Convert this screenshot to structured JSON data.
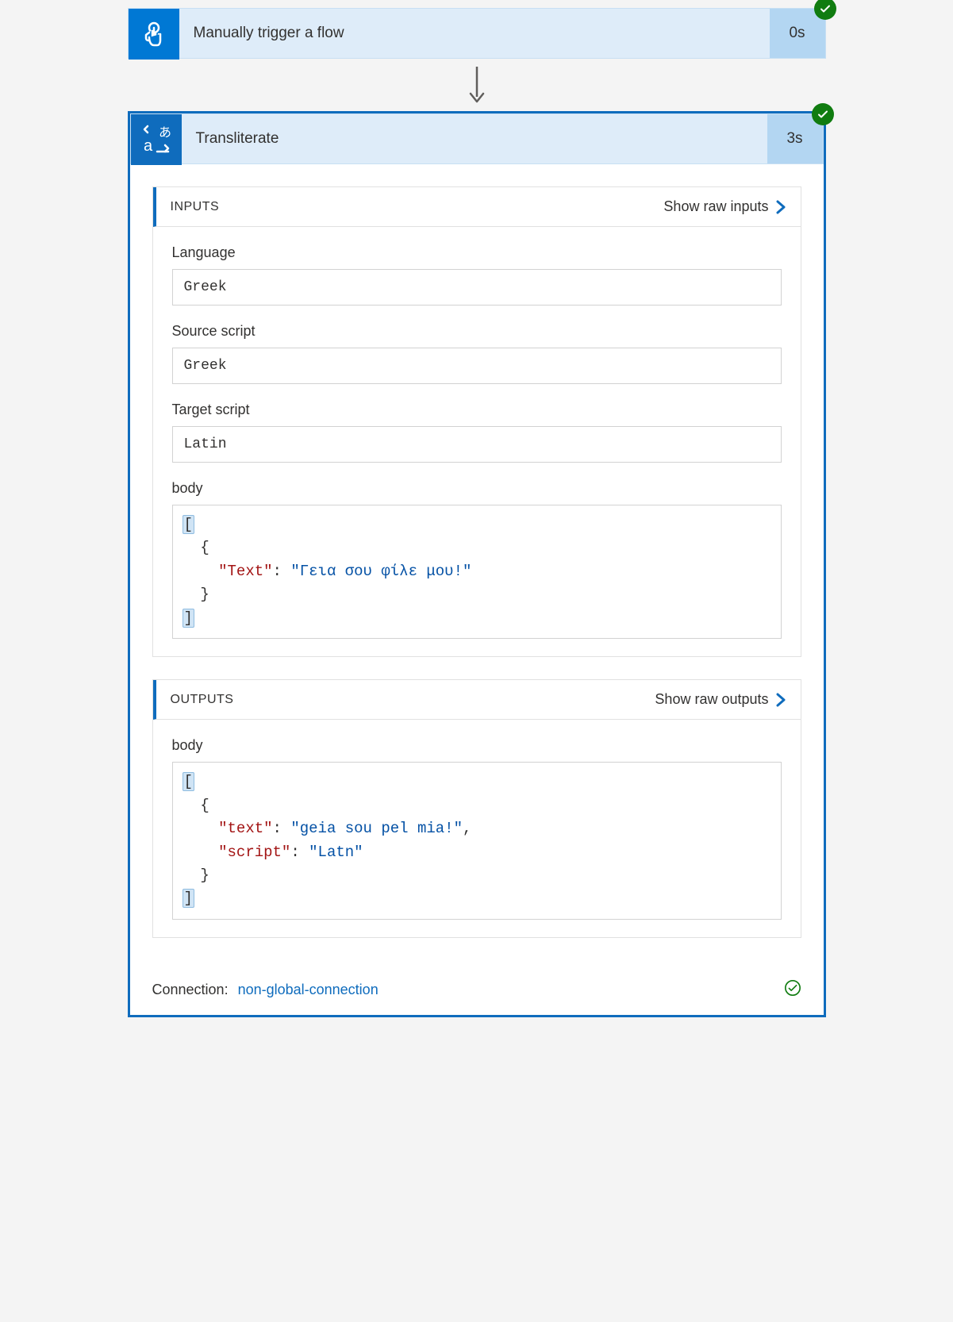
{
  "trigger": {
    "title": "Manually trigger a flow",
    "duration": "0s"
  },
  "action": {
    "title": "Transliterate",
    "duration": "3s",
    "inputs": {
      "header_title": "INPUTS",
      "show_raw_label": "Show raw inputs",
      "fields": {
        "language_label": "Language",
        "language_value": "Greek",
        "source_script_label": "Source script",
        "source_script_value": "Greek",
        "target_script_label": "Target script",
        "target_script_value": "Latin",
        "body_label": "body",
        "body_text_key": "\"Text\"",
        "body_text_value": "\"Γεια σου φίλε μου!\""
      }
    },
    "outputs": {
      "header_title": "OUTPUTS",
      "show_raw_label": "Show raw outputs",
      "body_label": "body",
      "body_text_key": "\"text\"",
      "body_text_value": "\"geia sou pel mia!\"",
      "body_script_key": "\"script\"",
      "body_script_value": "\"Latn\""
    }
  },
  "connection": {
    "label": "Connection:",
    "name": "non-global-connection"
  }
}
